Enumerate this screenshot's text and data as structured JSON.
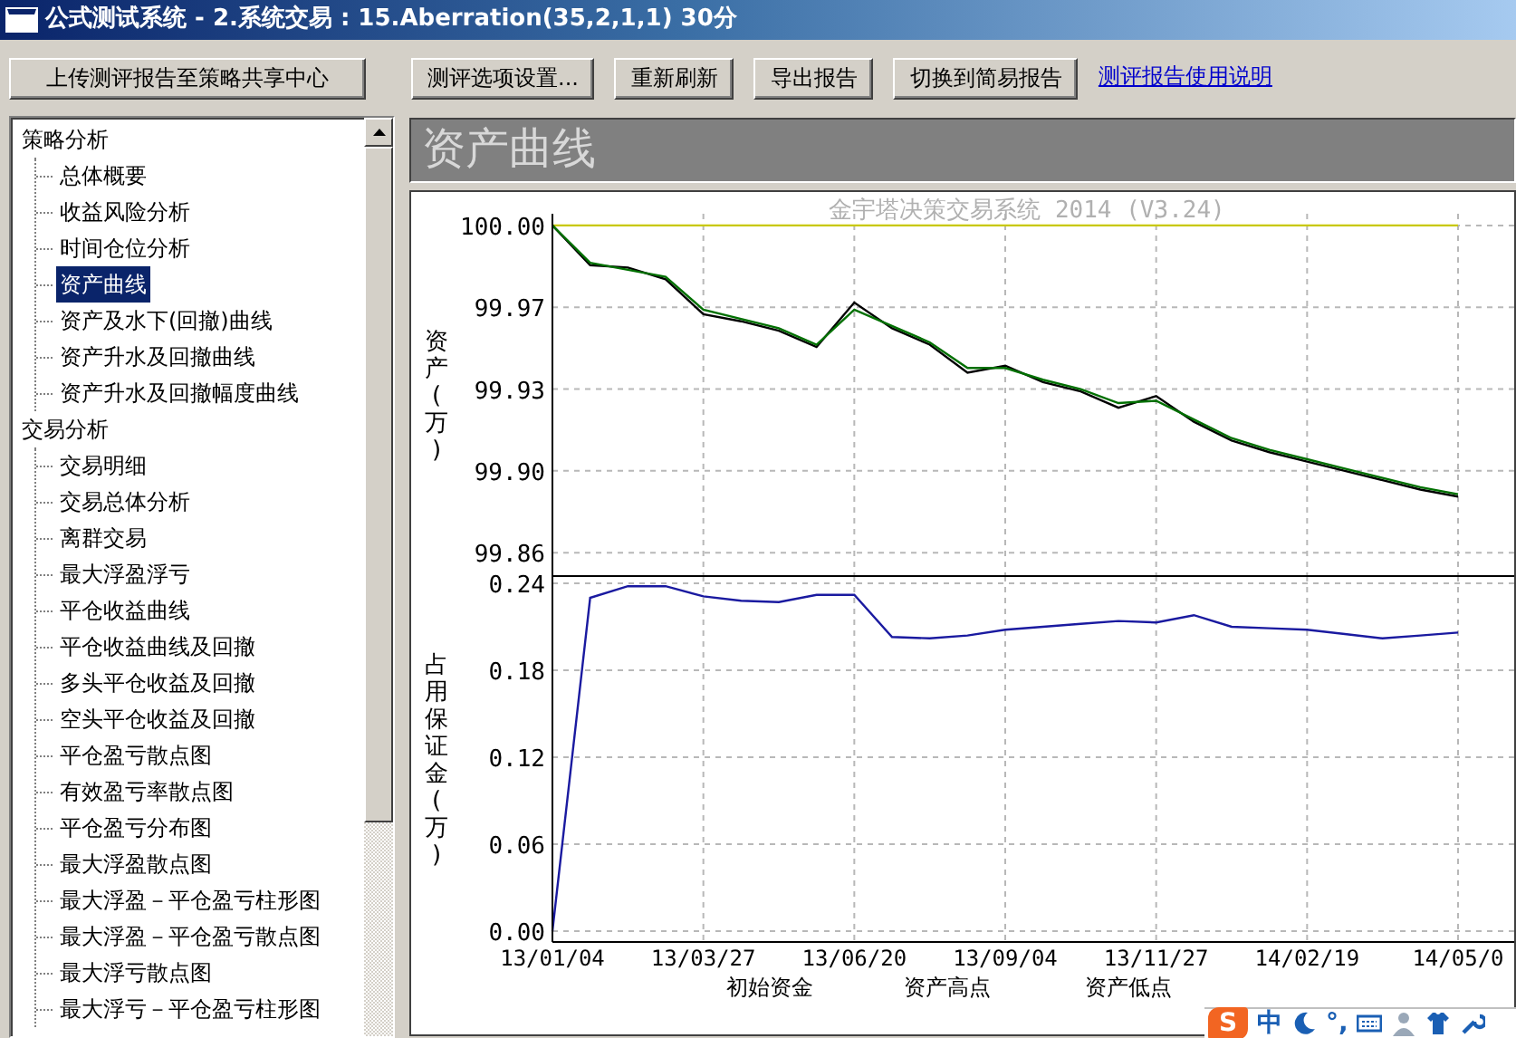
{
  "window": {
    "title": "公式测试系统 - 2.系统交易 : 15.Aberration(35,2,1,1) 30分"
  },
  "toolbar": [
    {
      "kind": "button",
      "label": "上传测评报告至策略共享中心"
    },
    {
      "kind": "button",
      "label": "测评选项设置..."
    },
    {
      "kind": "button",
      "label": "重新刷新"
    },
    {
      "kind": "button",
      "label": "导出报告"
    },
    {
      "kind": "button",
      "label": "切换到简易报告"
    },
    {
      "kind": "link",
      "label": "测评报告使用说明"
    }
  ],
  "sidebar": {
    "items": [
      {
        "label": "策略分析",
        "selected": false,
        "children": [
          {
            "label": "总体概要",
            "selected": false
          },
          {
            "label": "收益风险分析",
            "selected": false
          },
          {
            "label": "时间仓位分析",
            "selected": false
          },
          {
            "label": "资产曲线",
            "selected": true
          },
          {
            "label": "资产及水下(回撤)曲线",
            "selected": false
          },
          {
            "label": "资产升水及回撤曲线",
            "selected": false
          },
          {
            "label": "资产升水及回撤幅度曲线",
            "selected": false
          }
        ]
      },
      {
        "label": "交易分析",
        "selected": false,
        "children": [
          {
            "label": "交易明细",
            "selected": false
          },
          {
            "label": "交易总体分析",
            "selected": false
          },
          {
            "label": "离群交易",
            "selected": false
          },
          {
            "label": "最大浮盈浮亏",
            "selected": false
          },
          {
            "label": "平仓收益曲线",
            "selected": false
          },
          {
            "label": "平仓收益曲线及回撤",
            "selected": false
          },
          {
            "label": "多头平仓收益及回撤",
            "selected": false
          },
          {
            "label": "空头平仓收益及回撤",
            "selected": false
          },
          {
            "label": "平仓盈亏散点图",
            "selected": false
          },
          {
            "label": "有效盈亏率散点图",
            "selected": false
          },
          {
            "label": "平仓盈亏分布图",
            "selected": false
          },
          {
            "label": "最大浮盈散点图",
            "selected": false
          },
          {
            "label": "最大浮盈－平仓盈亏柱形图",
            "selected": false
          },
          {
            "label": "最大浮盈－平仓盈亏散点图",
            "selected": false
          },
          {
            "label": "最大浮亏散点图",
            "selected": false
          },
          {
            "label": "最大浮亏－平仓盈亏柱形图",
            "selected": false
          }
        ]
      }
    ]
  },
  "panel": {
    "title": "资产曲线",
    "charts": [
      {
        "chart_data": {
          "type": "line",
          "title": "金宇塔决策交易系统 2014 (V3.24)",
          "ylabel": "资产(万)",
          "ylim": [
            99.85,
            100.005
          ],
          "grid": true,
          "yticks": [
            {
              "value": 100.0,
              "label": "100.00"
            },
            {
              "value": 99.965,
              "label": "99.97"
            },
            {
              "value": 99.93,
              "label": "99.93"
            },
            {
              "value": 99.895,
              "label": "99.90"
            },
            {
              "value": 99.86,
              "label": "99.86"
            }
          ],
          "categories": [
            null,
            null,
            null,
            null,
            null,
            null,
            null,
            null,
            null,
            null,
            null,
            null,
            null,
            null,
            null,
            null,
            null,
            null,
            null,
            null,
            null,
            null,
            null,
            null,
            null
          ],
          "series": [
            {
              "color": "#c8c800",
              "values": [
                100.0,
                100.0,
                100.0,
                100.0,
                100.0,
                100.0,
                100.0,
                100.0,
                100.0,
                100.0,
                100.0,
                100.0,
                100.0,
                100.0,
                100.0,
                100.0,
                100.0,
                100.0,
                100.0,
                100.0,
                100.0,
                100.0,
                100.0,
                100.0,
                100.0
              ]
            },
            {
              "color": "#000000",
              "values": [
                100.0,
                99.983,
                99.982,
                99.977,
                99.962,
                99.959,
                99.955,
                99.948,
                99.967,
                99.956,
                99.949,
                99.937,
                99.94,
                99.933,
                99.929,
                99.922,
                99.927,
                99.916,
                99.908,
                99.903,
                99.899,
                99.895,
                99.891,
                99.887,
                99.884
              ]
            },
            {
              "color": "#007000",
              "values": [
                100.0,
                99.984,
                99.981,
                99.978,
                99.964,
                99.96,
                99.956,
                99.949,
                99.964,
                99.957,
                99.95,
                99.939,
                99.939,
                99.934,
                99.93,
                99.924,
                99.925,
                99.917,
                99.909,
                99.904,
                99.9,
                99.896,
                99.892,
                99.888,
                99.885
              ]
            }
          ]
        }
      },
      {
        "chart_data": {
          "type": "line",
          "ylabel": "占用保证金(万)",
          "ylim": [
            -0.0075,
            0.245
          ],
          "grid": true,
          "yticks": [
            {
              "value": 0.24,
              "label": "0.24"
            },
            {
              "value": 0.18,
              "label": "0.18"
            },
            {
              "value": 0.12,
              "label": "0.12"
            },
            {
              "value": 0.06,
              "label": "0.06"
            },
            {
              "value": 0.0,
              "label": "0.00"
            }
          ],
          "categories": [
            "13/01/04",
            null,
            null,
            null,
            "13/03/27",
            null,
            null,
            null,
            "13/06/20",
            null,
            null,
            null,
            "13/09/04",
            null,
            null,
            null,
            "13/11/27",
            null,
            null,
            null,
            "14/02/19",
            null,
            null,
            null,
            "14/05/0"
          ],
          "series": [
            {
              "color": "#1a1aa0",
              "values": [
                0,
                0.23,
                0.238,
                0.238,
                0.231,
                0.228,
                0.227,
                0.232,
                0.232,
                0.203,
                0.202,
                0.204,
                0.208,
                0.21,
                0.212,
                0.214,
                0.213,
                0.218,
                0.21,
                0.209,
                0.208,
                0.205,
                0.202,
                0.204,
                0.206
              ]
            }
          ]
        }
      }
    ],
    "legend": [
      "初始资金",
      "资产高点",
      "资产低点"
    ]
  },
  "ime": {
    "logo": "S",
    "mode": "中",
    "punctuation": "°,"
  }
}
